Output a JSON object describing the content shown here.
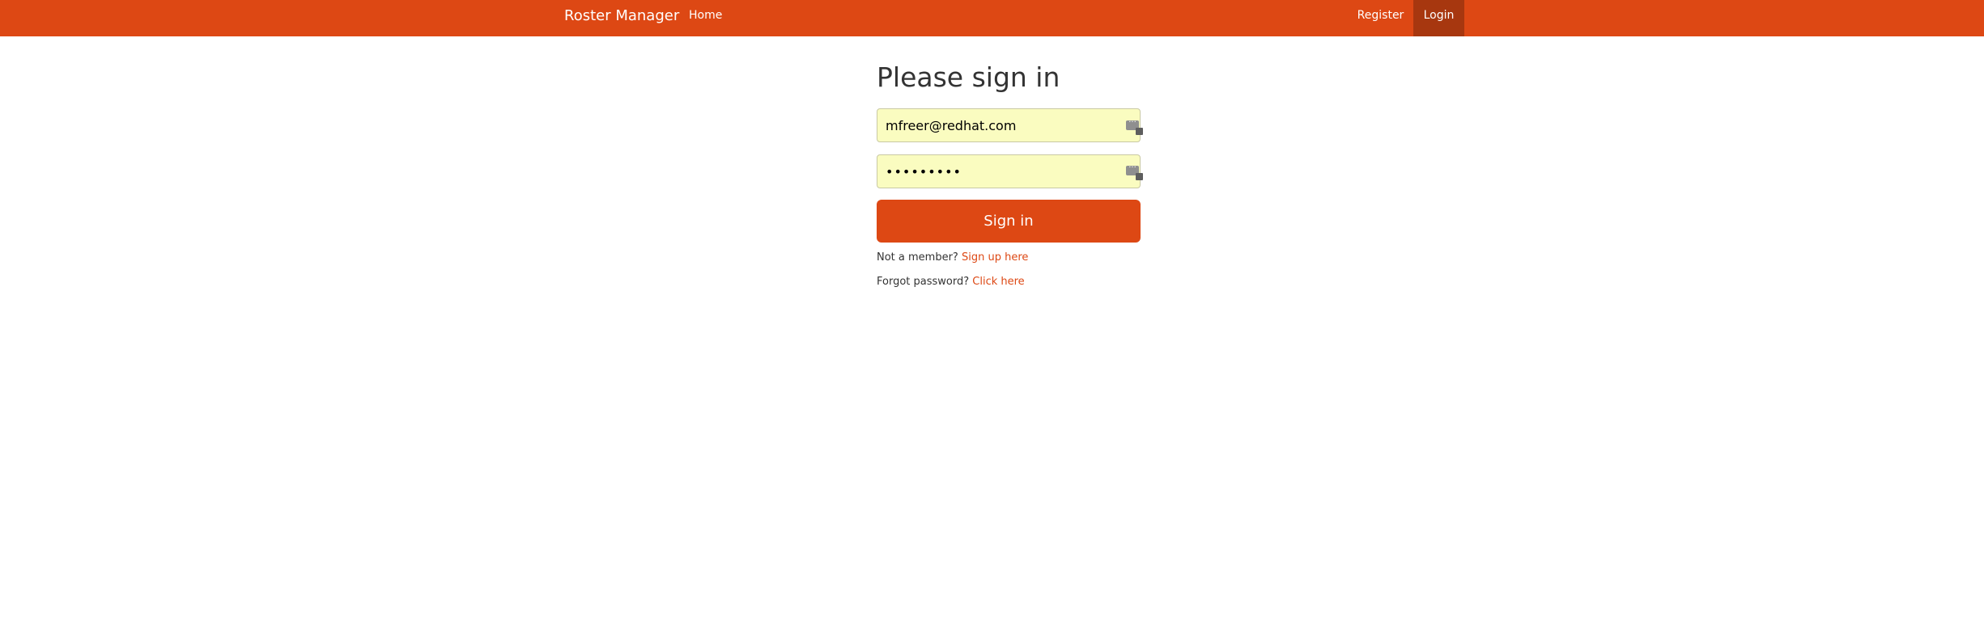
{
  "navbar": {
    "brand": "Roster Manager",
    "home_label": "Home",
    "register_label": "Register",
    "login_label": "Login",
    "color": "#dd4814",
    "active_color": "#a7370f"
  },
  "signin": {
    "heading": "Please sign in",
    "email_value": "mfreer@redhat.com",
    "password_value": "•••••••••",
    "button_label": "Sign in",
    "not_member_text": "Not a member?",
    "signup_link": "Sign up here",
    "forgot_text": "Forgot password?",
    "forgot_link": "Click here",
    "field_background": "#fafcc0"
  },
  "icons": {
    "autofill": "password-manager-autofill-icon"
  }
}
